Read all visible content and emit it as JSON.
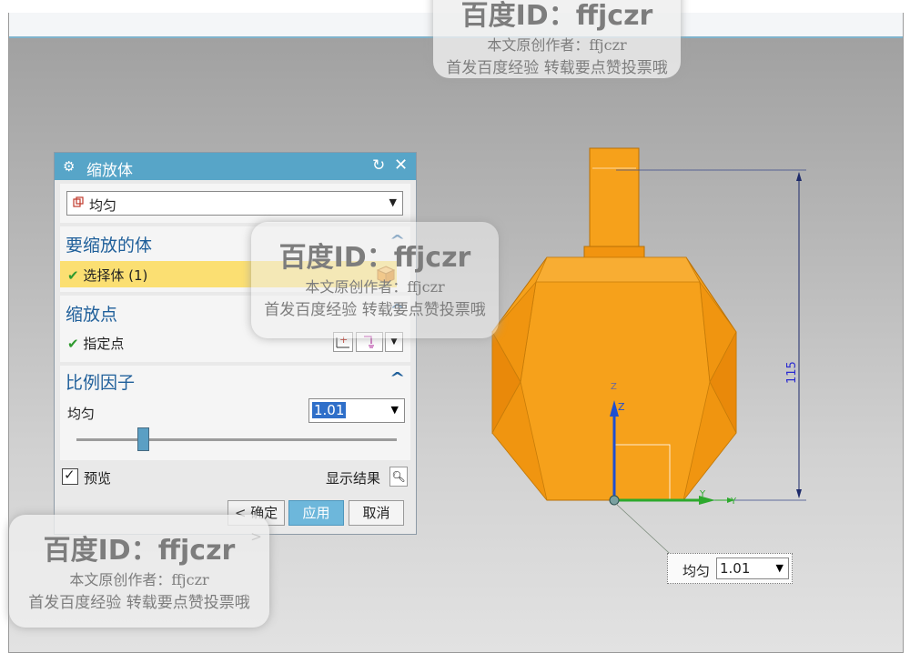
{
  "dialog": {
    "title": "缩放体",
    "type_value": "均匀",
    "sections": {
      "body": {
        "title": "要缩放的体",
        "row_label": "选择体 (1)"
      },
      "point": {
        "title": "缩放点",
        "row_label": "指定点"
      },
      "factor": {
        "title": "比例因子",
        "label": "均匀",
        "value": "1.01",
        "slider_fraction": 0.21
      }
    },
    "preview_label": "预览",
    "preview_checked": true,
    "show_result_label": "显示结果",
    "buttons": {
      "ok": "< 确定 >",
      "apply": "应用",
      "cancel": "取消"
    }
  },
  "viewport": {
    "dimension_label": "115",
    "axes": {
      "z": "Z",
      "y": "Y"
    },
    "model_color": "#f7a21a"
  },
  "onscreen_input": {
    "label": "均匀",
    "value": "1.01"
  },
  "watermarks": {
    "line1": "百度ID：ffjczr",
    "line2": "本文原创作者：ffjczr",
    "line3": "首发百度经验 转载要点赞投票哦"
  },
  "colors": {
    "title_bar": "#57a5c8",
    "section_title": "#1f5f9a",
    "selected_row": "#fbdf72",
    "apply_button": "#6db7db"
  }
}
